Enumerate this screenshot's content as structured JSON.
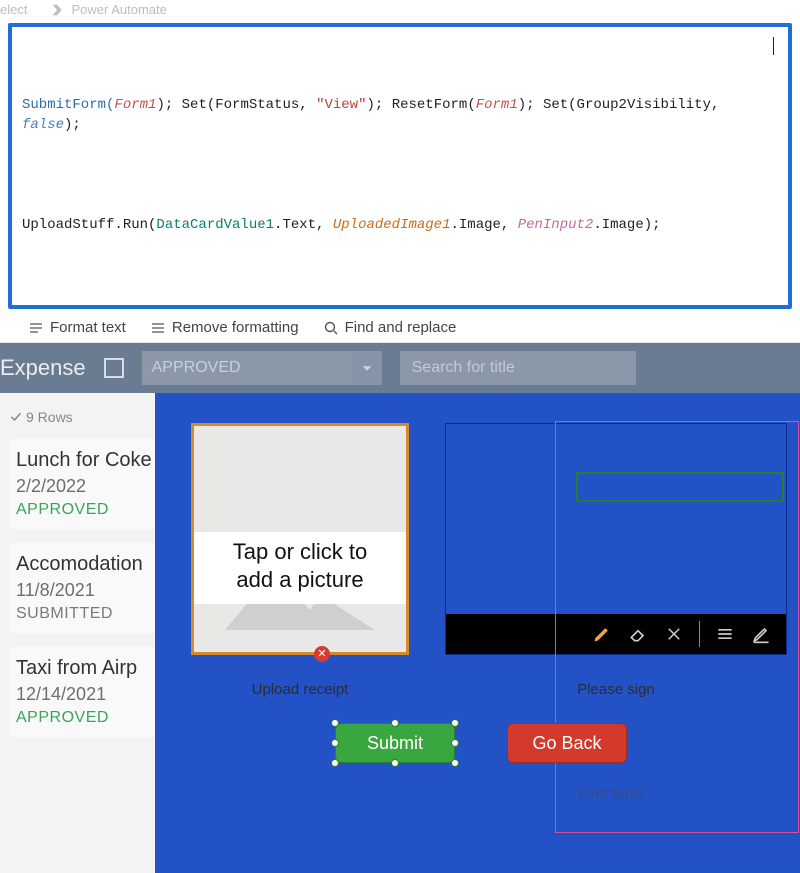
{
  "ribbon": {
    "select_label": "elect",
    "power_automate": "Power Automate"
  },
  "formula": {
    "line1_pre": "SubmitForm(",
    "form1": "Form1",
    "line1_mid1": "); Set(FormStatus, ",
    "view_str": "\"View\"",
    "line1_mid2": "); ResetForm(",
    "line1_mid3": "); Set(Group2Visibility, ",
    "false_kw": "false",
    "line1_end": ");",
    "line2_pre": "UploadStuff.Run(",
    "dcv": "DataCardValue1",
    "dot_text": ".Text, ",
    "upimg": "UploadedImage1",
    "dot_img1": ".Image, ",
    "pen": "PenInput2",
    "dot_img2": ".Image);"
  },
  "toolbar2": {
    "format": "Format text",
    "remove": "Remove formatting",
    "find": "Find and replace"
  },
  "header": {
    "title": "Expense",
    "dropdown": "APPROVED",
    "search_placeholder": "Search for title"
  },
  "rows_label": "9 Rows",
  "items": [
    {
      "title": "Lunch for Coke",
      "date": "2/2/2022",
      "status": "APPROVED",
      "statusClass": "st-approved"
    },
    {
      "title": "Accomodation",
      "date": "11/8/2021",
      "status": "SUBMITTED",
      "statusClass": "st-submitted"
    },
    {
      "title": "Taxi from Airp",
      "date": "12/14/2021",
      "status": "APPROVED",
      "statusClass": "st-approved"
    }
  ],
  "upload": {
    "hint_l1": "Tap or click to",
    "hint_l2": "add a picture",
    "caption": "Upload receipt"
  },
  "sign": {
    "caption": "Please sign"
  },
  "buttons": {
    "submit": "Submit",
    "goback": "Go Back"
  },
  "finditems": "Find items"
}
